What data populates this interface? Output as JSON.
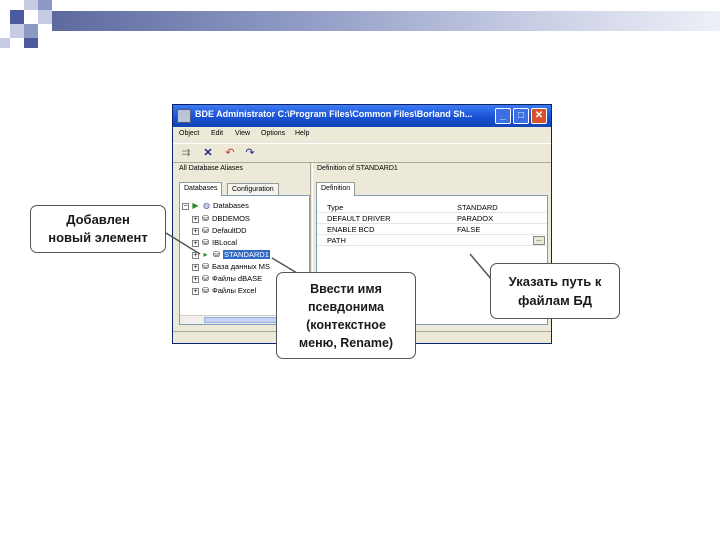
{
  "window": {
    "title": "BDE Administrator  C:\\Program Files\\Common Files\\Borland Sh...",
    "buttons": {
      "minimize": "_",
      "maximize": "□",
      "close": "✕"
    }
  },
  "menu": [
    "Object",
    "Edit",
    "View",
    "Options",
    "Help"
  ],
  "toolbar_icons": [
    "apply-icon",
    "delete-icon",
    "undo-icon",
    "redo-icon"
  ],
  "left_panel": {
    "header": "All Database Aliases",
    "tabs": [
      "Databases",
      "Configuration"
    ],
    "tree": [
      {
        "label": "Databases",
        "icon": "databases-icon"
      },
      {
        "label": "DBDEMOS",
        "icon": "db-icon"
      },
      {
        "label": "DefaultDD",
        "icon": "db-icon"
      },
      {
        "label": "IBLocal",
        "icon": "db-icon"
      },
      {
        "label": "STANDARD1",
        "icon": "db-icon",
        "selected": true
      },
      {
        "label": "База данных MS",
        "icon": "db-icon"
      },
      {
        "label": "Файлы dBASE",
        "icon": "db-icon"
      },
      {
        "label": "Файлы Excel",
        "icon": "db-icon"
      }
    ]
  },
  "right_panel": {
    "header": "Definition of STANDARD1",
    "tab": "Definition",
    "rows": [
      {
        "key": "Type",
        "value": "STANDARD"
      },
      {
        "key": "DEFAULT DRIVER",
        "value": "PARADOX"
      },
      {
        "key": "ENABLE BCD",
        "value": "FALSE"
      },
      {
        "key": "PATH",
        "value": ""
      }
    ],
    "ellipsis": "..."
  },
  "callouts": {
    "added": [
      "Добавлен",
      "новый элемент"
    ],
    "rename": [
      "Ввести имя",
      "псевдонима",
      "(контекстное",
      "меню, Rename)"
    ],
    "path": [
      "Указать путь к",
      "файлам БД"
    ]
  },
  "colors": {
    "deco_dark": "#4a5a9c",
    "deco_mid": "#8d98c3",
    "deco_light": "#c5cbe3",
    "titlebar": "#1c55d6",
    "selection": "#316ac5"
  }
}
